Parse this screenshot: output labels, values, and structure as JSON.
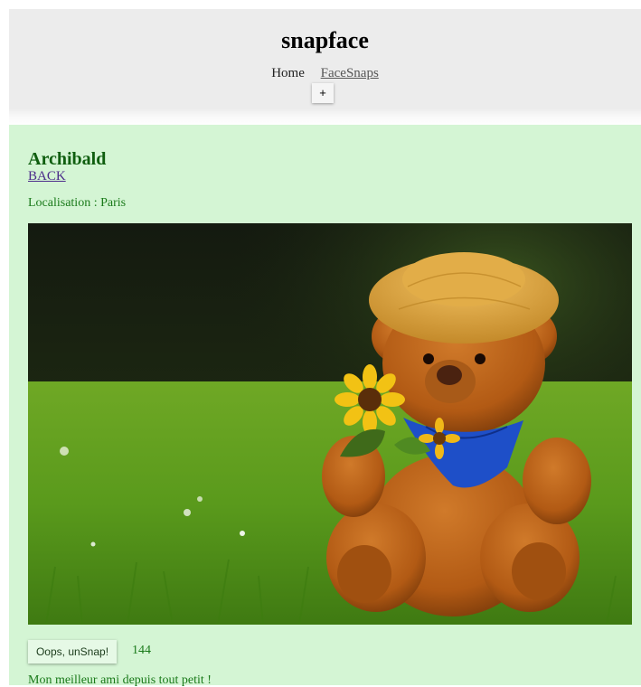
{
  "header": {
    "title": "snapface",
    "nav": {
      "home": "Home",
      "facesnaps": "FaceSnaps"
    },
    "add_label": "+"
  },
  "snap": {
    "title": "Archibald",
    "back_label": "BACK",
    "location": "Localisation : Paris",
    "image_alt": "teddy-bear-with-sunflower-photo",
    "snap_button_label": "Oops, unSnap!",
    "snaps": "144",
    "description": "Mon meilleur ami depuis tout petit !"
  },
  "colors": {
    "header_bg": "#ececec",
    "card_bg": "#d4f5d4",
    "card_text": "#1a7a1a",
    "title_text": "#0f5e0f"
  }
}
